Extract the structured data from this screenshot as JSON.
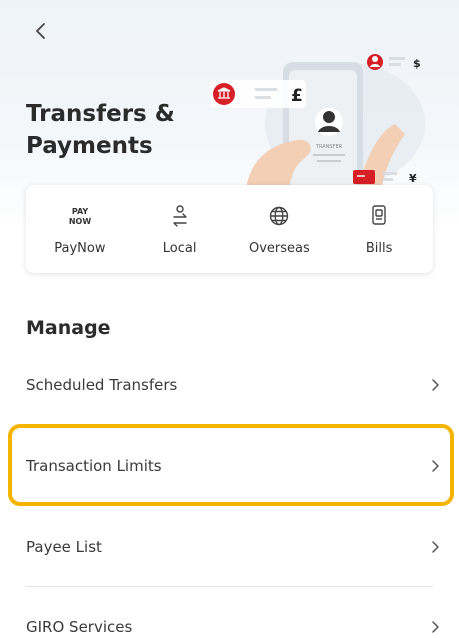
{
  "header": {
    "title_line1": "Transfers &",
    "title_line2": "Payments"
  },
  "illustration": {
    "currency_gbp": "£",
    "currency_usd": "$",
    "currency_yen": "¥",
    "card_label": "TRANSFER"
  },
  "quick_actions": [
    {
      "label": "PayNow",
      "icon": "paynow-logo-icon",
      "icon_text_top": "PAY",
      "icon_text_bottom": "NOW"
    },
    {
      "label": "Local",
      "icon": "local-transfer-icon"
    },
    {
      "label": "Overseas",
      "icon": "globe-icon"
    },
    {
      "label": "Bills",
      "icon": "bill-icon"
    }
  ],
  "manage": {
    "heading": "Manage",
    "items": [
      {
        "label": "Scheduled Transfers"
      },
      {
        "label": "Transaction Limits"
      },
      {
        "label": "Payee List"
      },
      {
        "label": "GIRO Services"
      }
    ]
  },
  "colors": {
    "brand_red": "#d61f26",
    "highlight": "#f5b400"
  }
}
